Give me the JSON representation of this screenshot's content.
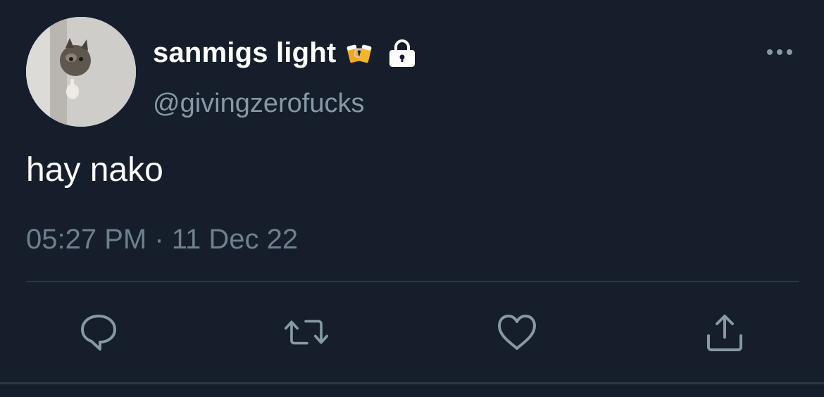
{
  "tweet": {
    "display_name": "sanmigs light",
    "handle": "@givingzerofucks",
    "text": "hay nako",
    "timestamp": "05:27 PM · 11 Dec 22",
    "name_emoji": "beer-mugs-emoji",
    "protected_icon": "lock-icon"
  },
  "actions": {
    "reply": "reply-icon",
    "retweet": "retweet-icon",
    "like": "heart-icon",
    "share": "share-icon"
  },
  "colors": {
    "background": "#151e2a",
    "primary_text": "#ffffff",
    "secondary_text": "#8899a6",
    "divider": "#2a3744"
  }
}
